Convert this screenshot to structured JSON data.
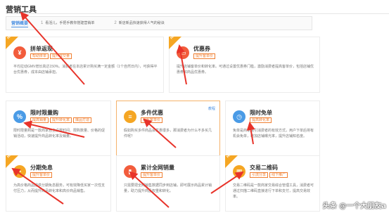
{
  "page": {
    "title": "营销工具"
  },
  "guide": {
    "tag": "营销概要",
    "steps": [
      {
        "num": "1",
        "text": "看活儿，手把手教你搭建营销单"
      },
      {
        "num": "2",
        "text": "新店新品快速获得人气的秘诀"
      }
    ]
  },
  "cards": [
    {
      "name": "拼单返现",
      "tags": [
        "帮助拼单",
        "提升成交量"
      ],
      "desc": "平均拉动GMV增长高达150%。消费者在本店累计购买满一定金额（1个自然日内），可获得平台优惠券，成本由店铺承担。",
      "icon": "money-icon",
      "icon_color": "#f25c3c",
      "hot": true,
      "hot_label": "HOT"
    },
    {
      "name": "优惠券",
      "tags": [
        "提升客单价"
      ],
      "desc": "提升店铺客单价和转化率。可通过设置优惠券门槛，激励消费者提高客单价，包括店铺优惠券和商品优惠券。",
      "icon": "ticket-icon",
      "icon_color": "#f25c3c",
      "hot": true,
      "hot_label": "HOT"
    },
    {
      "name": "限时限量购",
      "tags": [
        "提高销量",
        "提升转化率",
        "爆品打造"
      ],
      "desc": "限时限量购是一款商家自主设置时间、限购数量、价格的促销活动，快速提升商品转化率及销量。",
      "icon": "percent-icon",
      "icon_color": "#4a9be6",
      "hot": false,
      "hot_label": ""
    },
    {
      "name": "多件优惠",
      "tags": [
        "提升客单价"
      ],
      "desc": "假如购买多件商品会优惠很多，那消费者为什么不多买几件呢？",
      "icon": "layers-icon",
      "icon_color": "#f5a623",
      "hot": false,
      "hot_label": "",
      "tutorial": "教程"
    },
    {
      "name": "限时免单",
      "tags": [
        "提高转化率"
      ],
      "desc": "免单是商家吸引消费者的有效方式，用户下单后将有机会免单，增加店铺曝光率，提升店铺知名度。",
      "icon": "clock-icon",
      "icon_color": "#4a9be6",
      "hot": false,
      "hot_label": ""
    },
    {
      "name": "分期免息",
      "tags": [
        "提升客单价"
      ],
      "desc": "为高价格商品提供分期免息服务，可有效降低买家一次性支付压力，从而提升商品转化率和高价商品销售。",
      "icon": "installment-icon",
      "icon_color": "#f5a623",
      "hot": true,
      "hot_label": "HOT"
    },
    {
      "name": "累计全网销量",
      "tags": [
        "提升客单价"
      ],
      "desc": "只需要把全网销售数据同步到店铺，即可展示商品累计销量，助力提升商品权重和转化。",
      "icon": "chart-icon",
      "icon_color": "#f25c3c",
      "hot": false,
      "hot_label": ""
    },
    {
      "name": "交易二维码",
      "tags": [
        "引流分享",
        "线下推广"
      ],
      "desc": "交易二维码是一款商家交易综合管理工具，消费者可通过扫描二维码直接进行下单和支付，提高交易效率。",
      "icon": "qrcode-icon",
      "icon_color": "#f5a623",
      "hot": true,
      "hot_label": "HOT"
    }
  ],
  "watermark": "头条 @一个大朋友a"
}
